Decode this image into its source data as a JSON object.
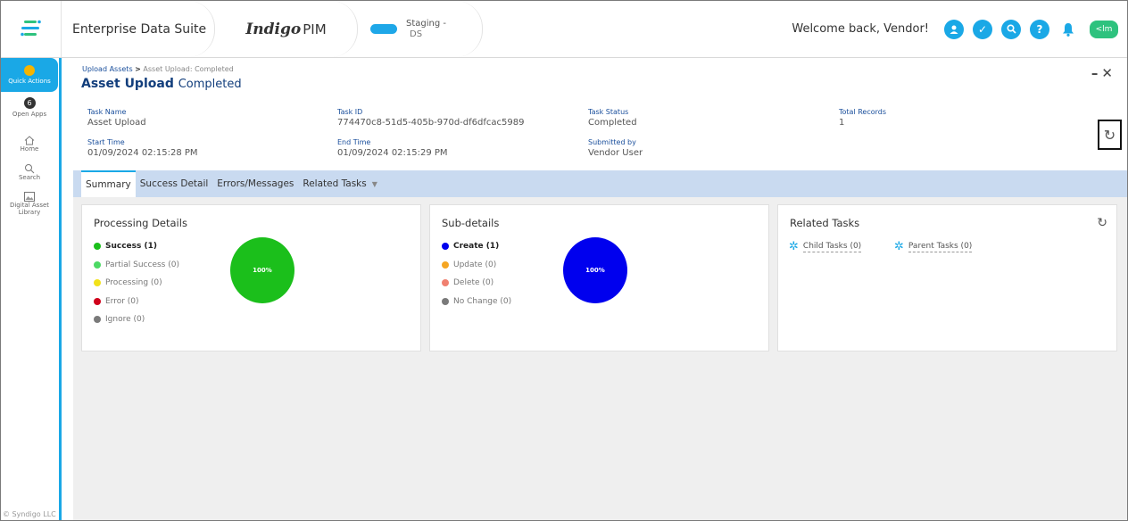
{
  "topbar": {
    "suite_name": "Enterprise Data Suite",
    "pim_brand": "Indigo",
    "pim_suffix": "PIM",
    "env_label": "Staging -",
    "env_sub": "DS",
    "welcome": "Welcome back, Vendor!",
    "user_badge": "<lm",
    "icons": [
      "user-icon",
      "check-circle-icon",
      "search-icon",
      "help-icon",
      "bell-icon"
    ],
    "accent_color": "#1aa8e6"
  },
  "sidebar": {
    "items": [
      {
        "label": "Quick Actions",
        "icon": "lightbulb-icon"
      },
      {
        "label": "Open Apps",
        "badge": "6"
      },
      {
        "label": "Home",
        "icon": "home-icon"
      },
      {
        "label": "Search",
        "icon": "search-icon"
      },
      {
        "label": "Digital Asset Library",
        "icon": "image-icon"
      }
    ],
    "copyright": "© Syndigo LLC"
  },
  "header": {
    "breadcrumb_parent": "Upload Assets",
    "breadcrumb_sep": ">",
    "breadcrumb_current": "Asset Upload: Completed",
    "title": "Asset Upload",
    "title_status": "Completed",
    "fields": {
      "task_name_label": "Task Name",
      "task_name": "Asset Upload",
      "task_id_label": "Task ID",
      "task_id": "774470c8-51d5-405b-970d-df6dfcac5989",
      "task_status_label": "Task Status",
      "task_status": "Completed",
      "total_records_label": "Total Records",
      "total_records": "1",
      "start_time_label": "Start Time",
      "start_time": "01/09/2024 02:15:28 PM",
      "end_time_label": "End Time",
      "end_time": "01/09/2024 02:15:29 PM",
      "submitted_by_label": "Submitted by",
      "submitted_by": "Vendor User"
    }
  },
  "tabs": [
    {
      "label": "Summary",
      "active": true
    },
    {
      "label": "Success Detail"
    },
    {
      "label": "Errors/Messages"
    },
    {
      "label": "Related Tasks"
    }
  ],
  "processing": {
    "title": "Processing Details",
    "items": [
      {
        "label": "Success (1)",
        "color": "#1bbf1b",
        "bold": true
      },
      {
        "label": "Partial Success (0)",
        "color": "#4cd964"
      },
      {
        "label": "Processing (0)",
        "color": "#f2e21a"
      },
      {
        "label": "Error (0)",
        "color": "#d0021b"
      },
      {
        "label": "Ignore (0)",
        "color": "#7a7a7a"
      }
    ],
    "pie_label": "100%",
    "pie_color": "#1bbf1b"
  },
  "subdetails": {
    "title": "Sub-details",
    "items": [
      {
        "label": "Create (1)",
        "color": "#0000ee",
        "bold": true
      },
      {
        "label": "Update (0)",
        "color": "#f5a623"
      },
      {
        "label": "Delete (0)",
        "color": "#f08070"
      },
      {
        "label": "No Change (0)",
        "color": "#7a7a7a"
      }
    ],
    "pie_label": "100%",
    "pie_color": "#0000ee"
  },
  "related": {
    "title": "Related Tasks",
    "child_tasks": "Child Tasks (0)",
    "parent_tasks": "Parent Tasks (0)"
  }
}
